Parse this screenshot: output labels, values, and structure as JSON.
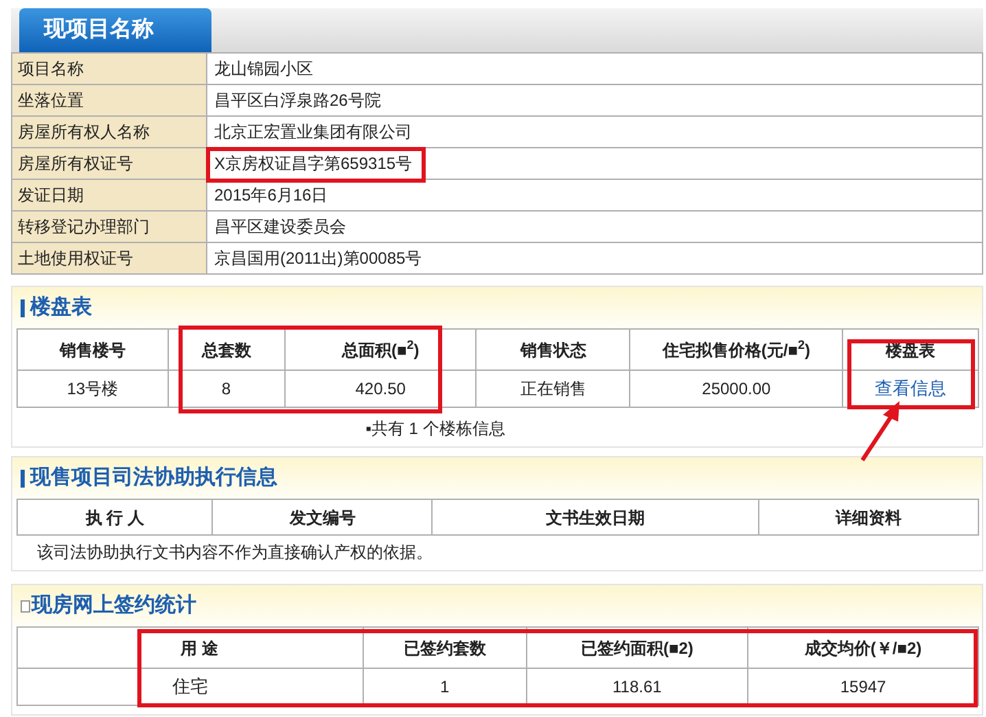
{
  "project": {
    "tab_title": "现项目名称",
    "rows": [
      {
        "label": "项目名称",
        "value": "龙山锦园小区"
      },
      {
        "label": "坐落位置",
        "value": "昌平区白浮泉路26号院"
      },
      {
        "label": "房屋所有权人名称",
        "value": "北京正宏置业集团有限公司"
      },
      {
        "label": "房屋所有权证号",
        "value": "X京房权证昌字第659315号"
      },
      {
        "label": "发证日期",
        "value": "2015年6月16日"
      },
      {
        "label": "转移登记办理部门",
        "value": "昌平区建设委员会"
      },
      {
        "label": "土地使用权证号",
        "value": "京昌国用(2011出)第00085号"
      }
    ]
  },
  "buildings": {
    "title": "楼盘表",
    "columns": [
      "销售楼号",
      "总套数",
      "总面积(■$^{2}$)",
      "销售状态",
      "住宅拟售价格(元/■$^{2}$)",
      "楼盘表"
    ],
    "rows": [
      {
        "cells": [
          "13号楼",
          "8",
          "420.50",
          "正在销售",
          "25000.00"
        ],
        "link": "查看信息"
      }
    ],
    "footnote": "▪共有 1 个楼栋信息"
  },
  "judicial": {
    "title": "现售项目司法协助执行信息",
    "columns": [
      "执 行 人",
      "发文编号",
      "文书生效日期",
      "详细资料"
    ],
    "note": "该司法协助执行文书内容不作为直接确认产权的依据。"
  },
  "contracts": {
    "title": "现房网上签约统计",
    "columns": [
      "用 途",
      "已签约套数",
      "已签约面积(■2)",
      "成交均价(￥/■2)"
    ],
    "rows": [
      [
        "住宅",
        "1",
        "118.61",
        "15947"
      ]
    ]
  }
}
